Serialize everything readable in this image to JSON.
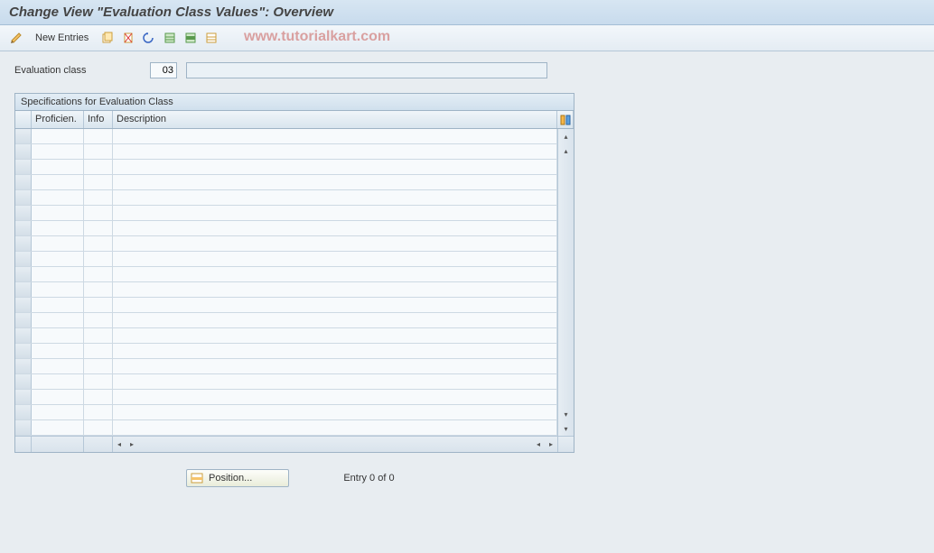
{
  "header": {
    "title": "Change View \"Evaluation Class Values\": Overview"
  },
  "toolbar": {
    "new_entries_label": "New Entries"
  },
  "watermark": "www.tutorialkart.com",
  "filter": {
    "label": "Evaluation class",
    "code": "03",
    "desc": ""
  },
  "table": {
    "panel_title": "Specifications for Evaluation Class",
    "columns": {
      "select": "",
      "prof": "Proficien.",
      "info": "Info",
      "desc": "Description"
    },
    "rows": [
      {
        "prof": "",
        "info": "",
        "desc": ""
      },
      {
        "prof": "",
        "info": "",
        "desc": ""
      },
      {
        "prof": "",
        "info": "",
        "desc": ""
      },
      {
        "prof": "",
        "info": "",
        "desc": ""
      },
      {
        "prof": "",
        "info": "",
        "desc": ""
      },
      {
        "prof": "",
        "info": "",
        "desc": ""
      },
      {
        "prof": "",
        "info": "",
        "desc": ""
      },
      {
        "prof": "",
        "info": "",
        "desc": ""
      },
      {
        "prof": "",
        "info": "",
        "desc": ""
      },
      {
        "prof": "",
        "info": "",
        "desc": ""
      },
      {
        "prof": "",
        "info": "",
        "desc": ""
      },
      {
        "prof": "",
        "info": "",
        "desc": ""
      },
      {
        "prof": "",
        "info": "",
        "desc": ""
      },
      {
        "prof": "",
        "info": "",
        "desc": ""
      },
      {
        "prof": "",
        "info": "",
        "desc": ""
      },
      {
        "prof": "",
        "info": "",
        "desc": ""
      },
      {
        "prof": "",
        "info": "",
        "desc": ""
      },
      {
        "prof": "",
        "info": "",
        "desc": ""
      },
      {
        "prof": "",
        "info": "",
        "desc": ""
      },
      {
        "prof": "",
        "info": "",
        "desc": ""
      }
    ]
  },
  "footer": {
    "position_label": "Position...",
    "entry_text": "Entry 0 of 0"
  }
}
